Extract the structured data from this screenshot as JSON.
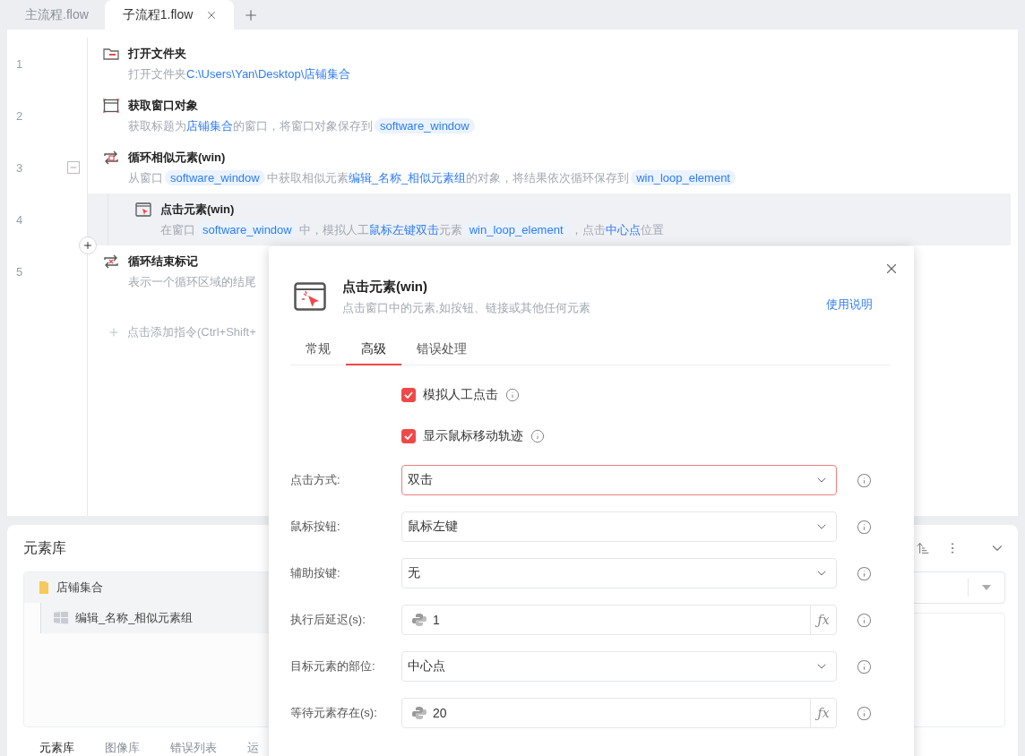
{
  "tabs": [
    {
      "label": "主流程.flow",
      "selected": false
    },
    {
      "label": "子流程1.flow",
      "selected": true
    }
  ],
  "steps": [
    {
      "line": "1",
      "kind": "folder",
      "title": "打开文件夹",
      "selected": false,
      "description": [
        {
          "kind": "text",
          "text": "打开文件夹"
        },
        {
          "kind": "link",
          "text": "C:\\Users\\Yan\\Desktop\\店铺集合"
        }
      ]
    },
    {
      "line": "2",
      "kind": "window",
      "title": "获取窗口对象",
      "selected": false,
      "description": [
        {
          "kind": "text",
          "text": "获取标题为"
        },
        {
          "kind": "link",
          "text": "店铺集合"
        },
        {
          "kind": "text",
          "text": "的窗口，将窗口对象保存到"
        },
        {
          "kind": "var",
          "text": "software_window"
        }
      ]
    },
    {
      "line": "3",
      "kind": "loop",
      "title": "循环相似元素(win)",
      "selected": false,
      "expanded": true,
      "description": [
        {
          "kind": "text",
          "text": "从窗口"
        },
        {
          "kind": "var",
          "text": "software_window"
        },
        {
          "kind": "text",
          "text": "中获取相似元素"
        },
        {
          "kind": "link",
          "text": "编辑_名称_相似元素组"
        },
        {
          "kind": "text",
          "text": "的对象，将结果依次循环保存到"
        },
        {
          "kind": "var",
          "text": "win_loop_element"
        }
      ],
      "children": [
        {
          "line": "4",
          "kind": "click",
          "title": "点击元素(win)",
          "selected": true,
          "description": [
            {
              "kind": "text",
              "text": "在窗口"
            },
            {
              "kind": "var",
              "text": "software_window"
            },
            {
              "kind": "text",
              "text": "中，模拟人工"
            },
            {
              "kind": "link",
              "text": "鼠标左键双击"
            },
            {
              "kind": "text",
              "text": "元素"
            },
            {
              "kind": "var",
              "text": "win_loop_element"
            },
            {
              "kind": "text",
              "text": "，点击"
            },
            {
              "kind": "link",
              "text": "中心点"
            },
            {
              "kind": "text",
              "text": "位置"
            }
          ]
        }
      ]
    },
    {
      "line": "5",
      "kind": "loop-end",
      "title": "循环结束标记",
      "selected": false,
      "description": [
        {
          "kind": "text",
          "text": "表示一个循环区域的结尾"
        }
      ]
    }
  ],
  "add_hint": "点击添加指令(Ctrl+Shift+",
  "element_library": {
    "title": "元素库",
    "tree": [
      {
        "label": "店铺集合",
        "kind": "folder",
        "children": [
          {
            "label": "编辑_名称_相似元素组",
            "kind": "element"
          }
        ]
      }
    ],
    "tabs": [
      {
        "label": "元素库",
        "selected": true
      },
      {
        "label": "图像库",
        "selected": false
      },
      {
        "label": "错误列表",
        "selected": false
      },
      {
        "label": "运",
        "selected": false
      }
    ]
  },
  "dialog": {
    "title": "点击元素(win)",
    "subtitle": "点击窗口中的元素,如按钮、链接或其他任何元素",
    "help_link": "使用说明",
    "tabs": [
      {
        "label": "常规",
        "selected": false
      },
      {
        "label": "高级",
        "selected": true
      },
      {
        "label": "错误处理",
        "selected": false
      }
    ],
    "checkboxes": [
      {
        "label": "模拟人工点击",
        "checked": true
      },
      {
        "label": "显示鼠标移动轨迹",
        "checked": true
      }
    ],
    "fields": [
      {
        "label": "点击方式:",
        "kind": "select",
        "value": "双击",
        "focused": true
      },
      {
        "label": "鼠标按钮:",
        "kind": "select",
        "value": "鼠标左键",
        "focused": false
      },
      {
        "label": "辅助按键:",
        "kind": "select",
        "value": "无",
        "focused": false
      },
      {
        "label": "执行后延迟(s):",
        "kind": "expression",
        "value": "1",
        "button": "ƒx",
        "focused": false
      },
      {
        "label": "目标元素的部位:",
        "kind": "select",
        "value": "中心点",
        "focused": false
      },
      {
        "label": "等待元素存在(s):",
        "kind": "expression",
        "value": "20",
        "button": "ƒx",
        "focused": false
      }
    ]
  }
}
